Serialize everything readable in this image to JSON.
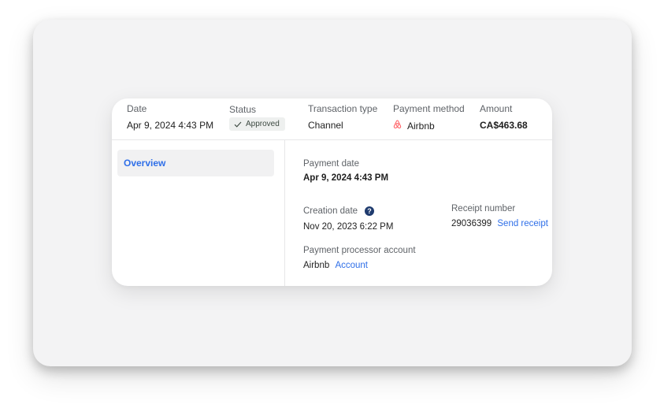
{
  "header": {
    "date": {
      "label": "Date",
      "value": "Apr 9, 2024 4:43 PM"
    },
    "status": {
      "label": "Status",
      "value": "Approved"
    },
    "transaction_type": {
      "label": "Transaction type",
      "value": "Channel"
    },
    "payment_method": {
      "label": "Payment method",
      "value": "Airbnb",
      "icon": "airbnb-logo-icon"
    },
    "amount": {
      "label": "Amount",
      "value": "CA$463.68"
    }
  },
  "sidebar": {
    "items": [
      {
        "label": "Overview",
        "active": true
      }
    ]
  },
  "details": {
    "payment_date": {
      "label": "Payment date",
      "value": "Apr 9, 2024 4:43 PM"
    },
    "creation_date": {
      "label": "Creation date",
      "value": "Nov 20, 2023 6:22 PM",
      "help_icon": "?"
    },
    "receipt": {
      "label": "Receipt number",
      "value": "29036399",
      "action": "Send receipt"
    },
    "processor": {
      "label": "Payment processor account",
      "value": "Airbnb",
      "link": "Account"
    }
  },
  "colors": {
    "accent": "#2f6fe8",
    "airbnb": "#ff5a5f",
    "help_badge": "#1f3b6e",
    "status_badge_bg": "#eef0ef"
  }
}
